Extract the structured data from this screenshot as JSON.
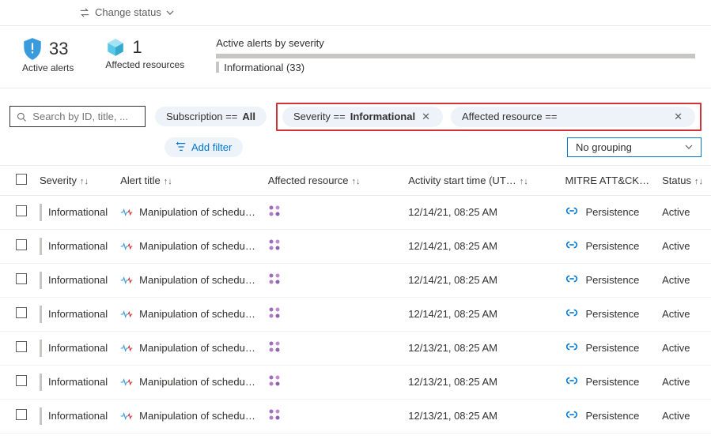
{
  "topbar": {
    "change_status": "Change status"
  },
  "summary": {
    "active_alerts_count": "33",
    "active_alerts_label": "Active alerts",
    "affected_count": "1",
    "affected_label": "Affected resources",
    "severity_title": "Active alerts by severity",
    "severity_line": "Informational (33)"
  },
  "filters": {
    "search_placeholder": "Search by ID, title, ...",
    "subscription_label": "Subscription == ",
    "subscription_value": "All",
    "severity_label": "Severity == ",
    "severity_value": "Informational",
    "affected_label": "Affected resource ==",
    "add_filter": "Add filter",
    "grouping": "No grouping"
  },
  "columns": {
    "severity": "Severity",
    "title": "Alert title",
    "resource": "Affected resource",
    "time": "Activity start time (UT…",
    "mitre": "MITRE ATT&CK…",
    "status": "Status"
  },
  "rows": [
    {
      "severity": "Informational",
      "title": "Manipulation of schedu…",
      "time": "12/14/21, 08:25 AM",
      "mitre": "Persistence",
      "status": "Active"
    },
    {
      "severity": "Informational",
      "title": "Manipulation of schedu…",
      "time": "12/14/21, 08:25 AM",
      "mitre": "Persistence",
      "status": "Active"
    },
    {
      "severity": "Informational",
      "title": "Manipulation of schedu…",
      "time": "12/14/21, 08:25 AM",
      "mitre": "Persistence",
      "status": "Active"
    },
    {
      "severity": "Informational",
      "title": "Manipulation of schedu…",
      "time": "12/14/21, 08:25 AM",
      "mitre": "Persistence",
      "status": "Active"
    },
    {
      "severity": "Informational",
      "title": "Manipulation of schedu…",
      "time": "12/13/21, 08:25 AM",
      "mitre": "Persistence",
      "status": "Active"
    },
    {
      "severity": "Informational",
      "title": "Manipulation of schedu…",
      "time": "12/13/21, 08:25 AM",
      "mitre": "Persistence",
      "status": "Active"
    },
    {
      "severity": "Informational",
      "title": "Manipulation of schedu…",
      "time": "12/13/21, 08:25 AM",
      "mitre": "Persistence",
      "status": "Active"
    }
  ]
}
